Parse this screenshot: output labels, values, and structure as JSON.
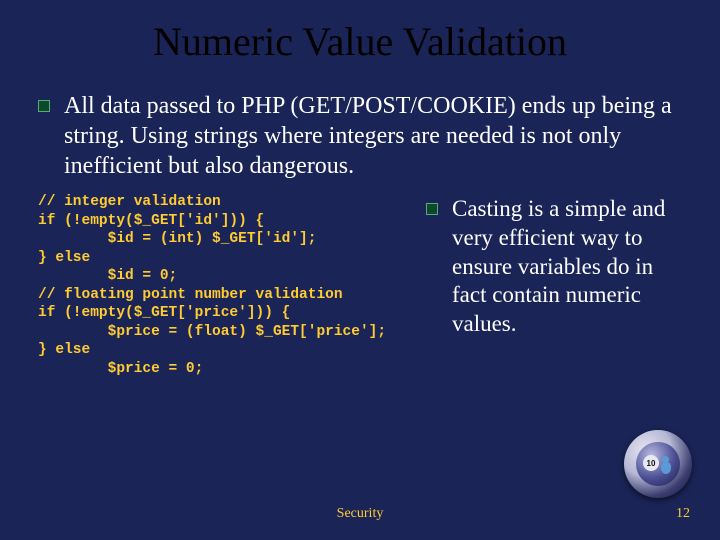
{
  "title": "Numeric Value Validation",
  "main_bullet": "All data passed to PHP (GET/POST/COOKIE) ends up being a string. Using strings where integers are needed is not only inefficient but also dangerous.",
  "code": "// integer validation\nif (!empty($_GET['id'])) {\n        $id = (int) $_GET['id'];\n} else\n        $id = 0;\n// floating point number validation\nif (!empty($_GET['price'])) {\n        $price = (float) $_GET['price'];\n} else\n        $price = 0;",
  "right_bullet": "Casting is a simple and very efficient way to ensure variables do in fact contain numeric values.",
  "footer": "Security",
  "page_number": "12",
  "badge_number": "10"
}
